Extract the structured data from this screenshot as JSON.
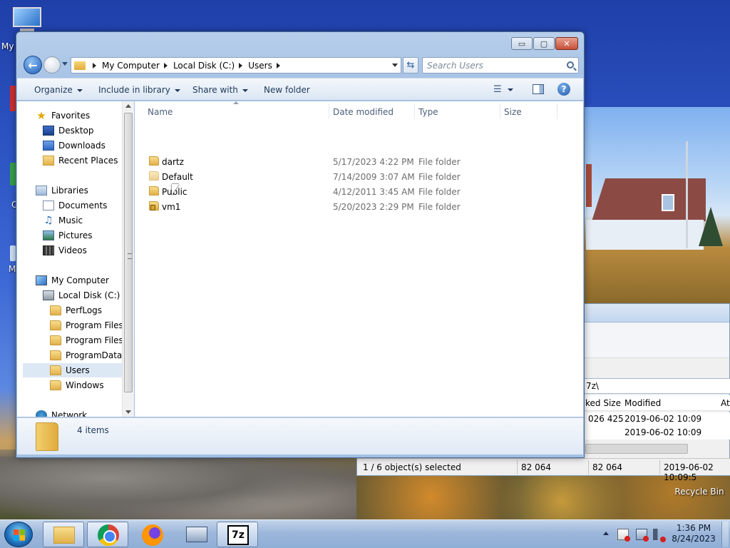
{
  "desktop": {
    "computer_label": "My",
    "side_letter_1": "C",
    "side_letter_2": "M",
    "recycle_bin_label": "Recycle Bin"
  },
  "sevenzip": {
    "path_fragment": "7z\\",
    "columns": [
      "ked Size",
      "Modified",
      "At"
    ],
    "rows": [
      {
        "packed": "026 425",
        "modified": "2019-06-02 10:09"
      },
      {
        "packed": "",
        "modified": "2019-06-02 10:09"
      }
    ],
    "status": {
      "selection": "1 / 6 object(s) selected",
      "size": "82 064",
      "packed": "82 064",
      "modified": "2019-06-02 10:09:5"
    }
  },
  "explorer": {
    "caption": {
      "minimize": "▭",
      "maximize": "▢",
      "close": "✕"
    },
    "breadcrumb": [
      "My Computer",
      "Local Disk (C:)",
      "Users"
    ],
    "search_placeholder": "Search Users",
    "toolbar": {
      "organize": "Organize",
      "include_in_library": "Include in library",
      "share_with": "Share with",
      "new_folder": "New folder",
      "help": "?"
    },
    "nav": {
      "favorites": "Favorites",
      "desktop": "Desktop",
      "downloads": "Downloads",
      "recent_places": "Recent Places",
      "libraries": "Libraries",
      "documents": "Documents",
      "music": "Music",
      "pictures": "Pictures",
      "videos": "Videos",
      "my_computer": "My Computer",
      "local_disk": "Local Disk (C:)",
      "folders": [
        "PerfLogs",
        "Program Files",
        "Program Files (",
        "ProgramData",
        "Users",
        "Windows"
      ],
      "network": "Network",
      "selected": "Users"
    },
    "columns": {
      "name": "Name",
      "date_modified": "Date modified",
      "type": "Type",
      "size": "Size"
    },
    "files": [
      {
        "name": "dartz",
        "date": "5/17/2023 4:22 PM",
        "type": "File folder"
      },
      {
        "name": "Default",
        "date": "7/14/2009 3:07 AM",
        "type": "File folder"
      },
      {
        "name": "Public",
        "date": "4/12/2011 3:45 AM",
        "type": "File folder"
      },
      {
        "name": "vm1",
        "date": "5/20/2023 2:29 PM",
        "type": "File folder"
      }
    ],
    "item_count": "4 items"
  },
  "taskbar": {
    "sevenzip_label": "7z",
    "time": "1:36 PM",
    "date": "8/24/2023"
  }
}
